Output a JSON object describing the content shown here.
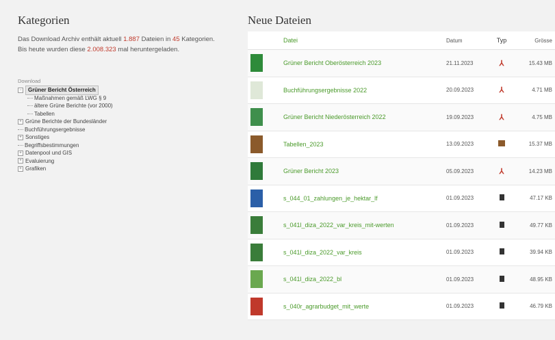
{
  "left": {
    "title": "Kategorien",
    "intro": {
      "t1": "Das Download Archiv enthält aktuell ",
      "files": "1.887",
      "t2": " Dateien in ",
      "cats": "45",
      "t3": " Kategorien.",
      "t4": "Bis heute wurden diese ",
      "downloads": "2.008.323",
      "t5": " mal heruntergeladen."
    },
    "tree": {
      "root": "Download",
      "items": [
        {
          "label": "Grüner Bericht Österreich",
          "level": 1,
          "box": "−",
          "selected": true
        },
        {
          "label": "Maßnahmen gemäß LWG § 9",
          "level": 2
        },
        {
          "label": "ältere Grüne Berichte (vor 2000)",
          "level": 2
        },
        {
          "label": "Tabellen",
          "level": 2
        },
        {
          "label": "Grüne Berichte der Bundesländer",
          "level": 1,
          "box": "+"
        },
        {
          "label": "Buchführungsergebnisse",
          "level": 1
        },
        {
          "label": "Sonstiges",
          "level": 1,
          "box": "+"
        },
        {
          "label": "Begriffsbestimmungen",
          "level": 1
        },
        {
          "label": "Datenpool und GIS",
          "level": 1,
          "box": "+"
        },
        {
          "label": "Evaluierung",
          "level": 1,
          "box": "+"
        },
        {
          "label": "Grafiken",
          "level": 1,
          "box": "+"
        }
      ]
    }
  },
  "right": {
    "title": "Neue Dateien",
    "headers": {
      "file": "Datei",
      "date": "Datum",
      "type": "Typ",
      "size": "Grösse"
    },
    "rows": [
      {
        "name": "Grüner Bericht Oberösterreich 2023",
        "date": "21.11.2023",
        "type": "pdf",
        "size": "15.43 MB",
        "thumb": "#2e8b3a"
      },
      {
        "name": "Buchführungsergebnisse 2022",
        "date": "20.09.2023",
        "type": "pdf",
        "size": "4.71 MB",
        "thumb": "#dfe8d8"
      },
      {
        "name": "Grüner Bericht Niederösterreich 2022",
        "date": "19.09.2023",
        "type": "pdf",
        "size": "4.75 MB",
        "thumb": "#3f8f4c"
      },
      {
        "name": "Tabellen_2023",
        "date": "13.09.2023",
        "type": "zip",
        "size": "15.37 MB",
        "thumb": "#8b5a2b"
      },
      {
        "name": "Grüner Bericht 2023",
        "date": "05.09.2023",
        "type": "pdf",
        "size": "14.23 MB",
        "thumb": "#2f7a3a"
      },
      {
        "name": "s_044_01_zahlungen_je_hektar_lf",
        "date": "01.09.2023",
        "type": "doc",
        "size": "47.17 KB",
        "thumb": "#2b5fa8"
      },
      {
        "name": "s_041l_diza_2022_var_kreis_mit-werten",
        "date": "01.09.2023",
        "type": "doc",
        "size": "49.77 KB",
        "thumb": "#3a7d3a"
      },
      {
        "name": "s_041l_diza_2022_var_kreis",
        "date": "01.09.2023",
        "type": "doc",
        "size": "39.94 KB",
        "thumb": "#3a7d3a"
      },
      {
        "name": "s_041l_diza_2022_bl",
        "date": "01.09.2023",
        "type": "doc",
        "size": "48.95 KB",
        "thumb": "#6aa84f"
      },
      {
        "name": "s_040r_agrarbudget_mit_werte",
        "date": "01.09.2023",
        "type": "doc",
        "size": "46.79 KB",
        "thumb": "#c0392b"
      }
    ]
  }
}
